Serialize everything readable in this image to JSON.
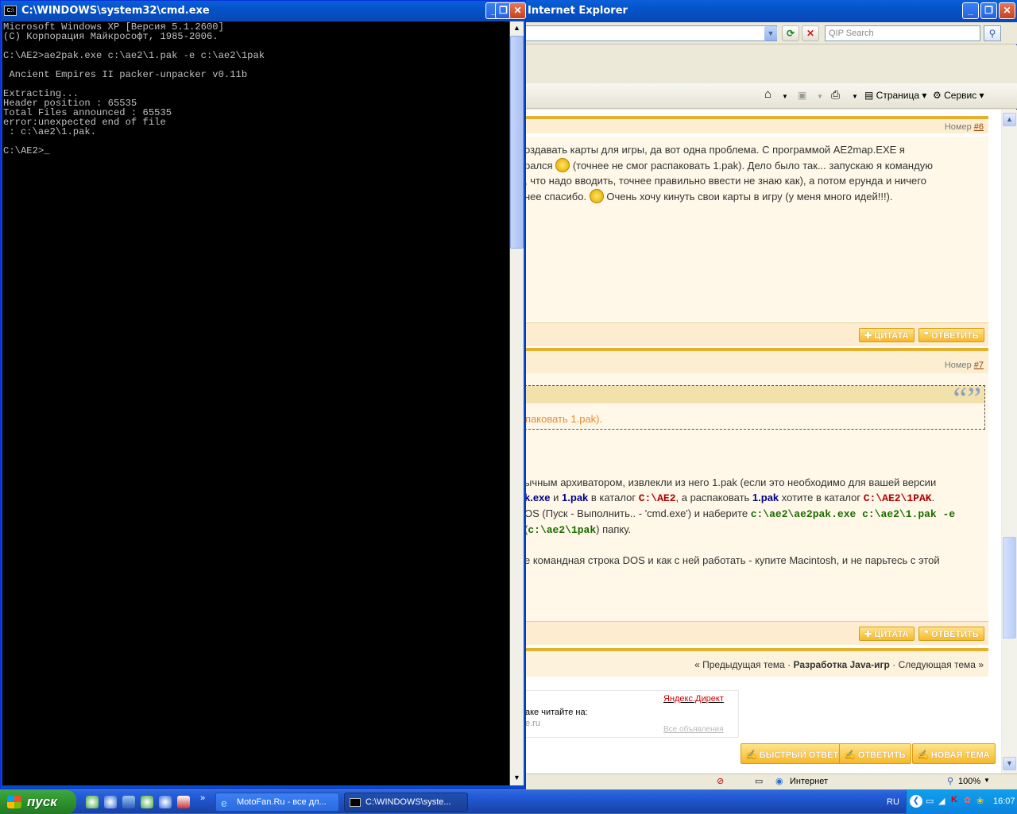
{
  "ie": {
    "title": "Internet Explorer",
    "qip_placeholder": "QIP Search",
    "commands": {
      "page": "Страница",
      "service": "Сервис"
    },
    "status_zone": "Интернет",
    "zoom": "100%"
  },
  "forum": {
    "post6": {
      "number_label": "Номер",
      "number": "#6",
      "lines": [
        "оздавать карты для игры, да вот одна проблема. С программой AE2map.EXE я",
        "рался",
        "(точнее не смог распаковать 1.pak). Дело было так... запускаю я командую",
        ", что надо вводить, точнее правильно ввести не знаю как), а потом ерунда и ничего",
        "нее спасибо.",
        "Очень хочу кинуть свои карты в игру (у меня много идей!!!)."
      ]
    },
    "post7": {
      "number_label": "Номер",
      "number": "#7",
      "quote_text": "паковать 1.pak).",
      "p1": "ычным архиватором, извлекли из него 1.pak (если это необходимо для вашей версии",
      "p2a": "k.exe",
      "p2b": " и ",
      "p2c": "1.pak",
      "p2d": " в каталог ",
      "p2e": "C:\\AE2",
      "p2f": ", а распаковать ",
      "p2g": "1.pak",
      "p2h": " хотите в каталог ",
      "p2i": "C:\\AE2\\1PAK",
      "p2j": ".",
      "p3a": "OS (Пуск - Выполнить.. - 'cmd.exe') и наберите ",
      "p3b": "c:\\ae2\\ae2pak.exe c:\\ae2\\1.pak -e",
      "p4a": "(",
      "p4b": "c:\\ae2\\1pak",
      "p4c": ") папку.",
      "p5": "е командная строка DOS и как с ней работать - купите Macintosh, и не парьтесь с этой"
    },
    "quote_btn": "ЦИТАТА",
    "reply_btn": "ОТВЕТИТЬ",
    "nav_prev": "« Предыдущая тема",
    "nav_sep": "·",
    "nav_current": "Разработка Java-игр",
    "nav_next": "Следующая тема »",
    "ad_title": "Яндекс.Директ",
    "ad_text": "аке читайте на:",
    "ad_link": "e.ru",
    "ad_all": "Все объявления",
    "btn_quick": "БЫСТРЫЙ ОТВЕТ",
    "btn_reply": "ОТВЕТИТЬ",
    "btn_new": "НОВАЯ ТЕМА"
  },
  "cmd": {
    "title": "C:\\WINDOWS\\system32\\cmd.exe",
    "icon_text": "C:\\",
    "output": "Microsoft Windows XP [Версия 5.1.2600]\n(С) Корпорация Майкрософт, 1985-2006.\n\nC:\\AE2>ae2pak.exe c:\\ae2\\1.pak -e c:\\ae2\\1pak\n\n Ancient Empires II packer-unpacker v0.11b\n\nExtracting...\nHeader position : 65535\nTotal Files announced : 65535\nerror:unexpected end of file\n : c:\\ae2\\1.pak.\n\nC:\\AE2>_"
  },
  "taskbar": {
    "start": "пуск",
    "tasks": [
      {
        "label": "MotoFan.Ru - все дл..."
      },
      {
        "label": "C:\\WINDOWS\\syste..."
      }
    ],
    "lang": "RU",
    "time": "16:07",
    "ql_more": "»"
  }
}
